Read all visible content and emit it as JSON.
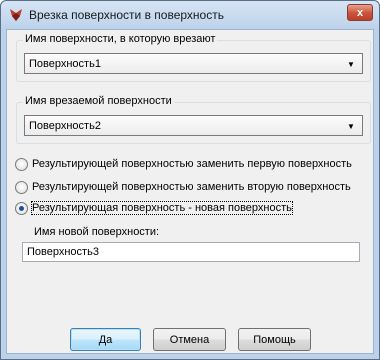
{
  "window": {
    "title": "Врезка поверхности в поверхность",
    "close_label": "x"
  },
  "group_target": {
    "label": "Имя поверхности, в которую врезают",
    "selected": "Поверхность1"
  },
  "group_cut": {
    "label": "Имя врезаемой поверхности",
    "selected": "Поверхность2"
  },
  "options": [
    {
      "label": "Результирующей поверхностью заменить первую поверхность",
      "checked": false
    },
    {
      "label": "Результирующей поверхностью заменить вторую поверхность",
      "checked": false
    },
    {
      "label": "Результирующая поверхность - новая поверхность",
      "checked": true
    }
  ],
  "new_surface": {
    "label": "Имя новой поверхности:",
    "value": "Поверхность3"
  },
  "buttons": {
    "ok": "Да",
    "cancel": "Отмена",
    "help": "Помощь"
  },
  "colors": {
    "accent": "#3c7fb1",
    "close": "#c9533a",
    "titlebar": "#bcd2ea"
  }
}
